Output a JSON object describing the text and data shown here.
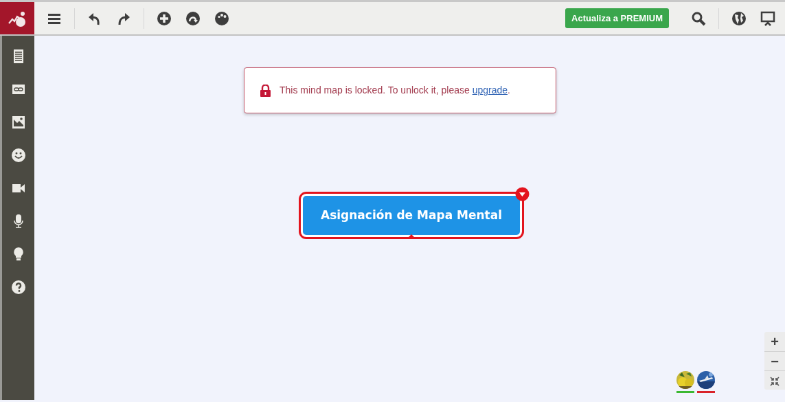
{
  "toolbar": {
    "premium_button": "Actualiza a PREMIUM"
  },
  "notice": {
    "text": "This mind map is locked. To unlock it, please ",
    "link": "upgrade",
    "end": "."
  },
  "node": {
    "label": "Asignación de Mapa Mental",
    "selected": true
  },
  "zoom_controls": [
    "+",
    "−"
  ],
  "collaborators": [
    {
      "color": "#3cb832"
    },
    {
      "color": "#d9232a"
    }
  ]
}
